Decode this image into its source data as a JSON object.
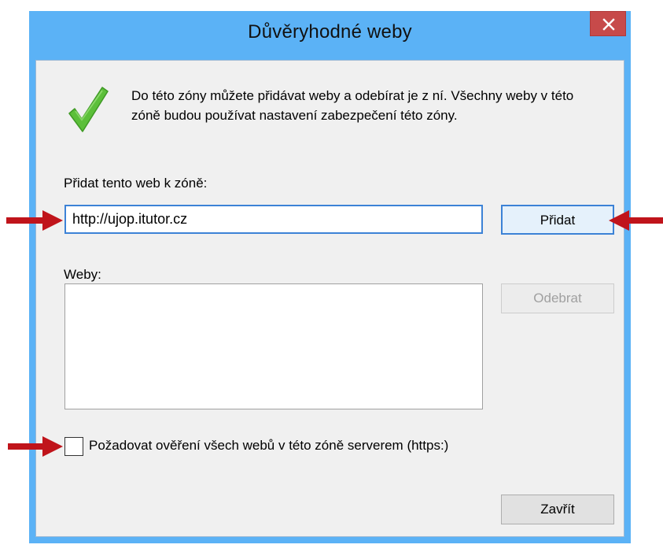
{
  "window": {
    "title": "Důvěryhodné weby",
    "close_glyph": "✕"
  },
  "description": "Do této zóny můžete přidávat weby a odebírat je z ní. Všechny weby v této zóně budou používat nastavení zabezpečení této zóny.",
  "add_site": {
    "label": "Přidat tento web k zóně:",
    "value": "http://ujop.itutor.cz",
    "button_label": "Přidat"
  },
  "sites": {
    "label": "Weby:",
    "items": [],
    "remove_label": "Odebrat"
  },
  "require_https": {
    "label": "Požadovat ověření všech webů v této zóně serverem (https:)",
    "checked": false
  },
  "close_button_label": "Zavřít",
  "icons": {
    "status": "checkmark-icon",
    "annotation": "red-arrow-icon"
  },
  "colors": {
    "titlebar": "#5bb2f6",
    "close_button": "#c74a4a",
    "focus_border": "#3c82d6",
    "annotation_arrow": "#c0141b",
    "checkmark": "#5cbf3a"
  }
}
